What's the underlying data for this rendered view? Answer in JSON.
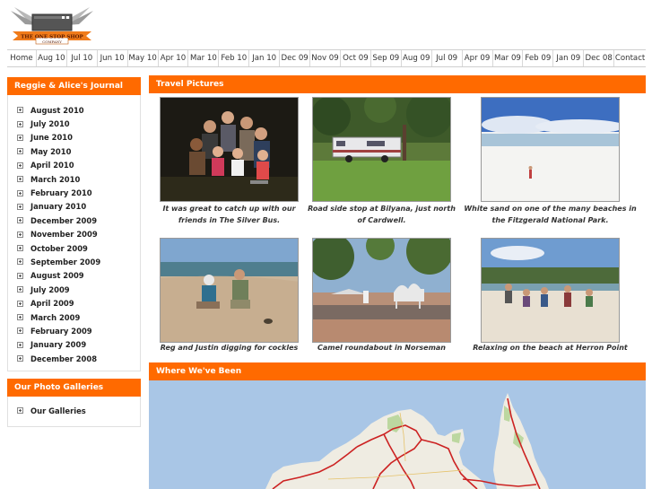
{
  "logo": {
    "line1": "THE ONE STOP SHOP",
    "line2": "COMPANY"
  },
  "nav": [
    "Home",
    "Aug 10",
    "Jul 10",
    "Jun 10",
    "May 10",
    "Apr 10",
    "Mar 10",
    "Feb 10",
    "Jan 10",
    "Dec 09",
    "Nov 09",
    "Oct 09",
    "Sep 09",
    "Aug 09",
    "Jul 09",
    "Apr 09",
    "Mar 09",
    "Feb 09",
    "Jan 09",
    "Dec 08",
    "Contact"
  ],
  "journal": {
    "title": "Reggie & Alice's Journal",
    "items": [
      "August 2010",
      "July 2010",
      "June 2010",
      "May 2010",
      "April 2010",
      "March 2010",
      "February 2010",
      "January 2010",
      "December 2009",
      "November 2009",
      "October 2009",
      "September 2009",
      "August 2009",
      "July 2009",
      "April 2009",
      "March 2009",
      "February 2009",
      "January 2009",
      "December 2008"
    ]
  },
  "galleries": {
    "title": "Our Photo Galleries",
    "items": [
      "Our Galleries"
    ]
  },
  "travel": {
    "title": "Travel Pictures",
    "photos": [
      {
        "caption": "It was great to catch up with our friends in The Silver Bus."
      },
      {
        "caption": "Road side stop at Bilyana, just north of Cardwell."
      },
      {
        "caption": "White sand on one of the many beaches in the Fitzgerald National Park."
      },
      {
        "caption": "Reg and Justin digging for cockles"
      },
      {
        "caption": "Camel roundabout in Norseman"
      },
      {
        "caption": "Relaxing on the beach at Herron Point"
      }
    ]
  },
  "map": {
    "title": "Where We've Been"
  },
  "colors": {
    "accent": "#ff6a00",
    "route": "#cc2222"
  }
}
